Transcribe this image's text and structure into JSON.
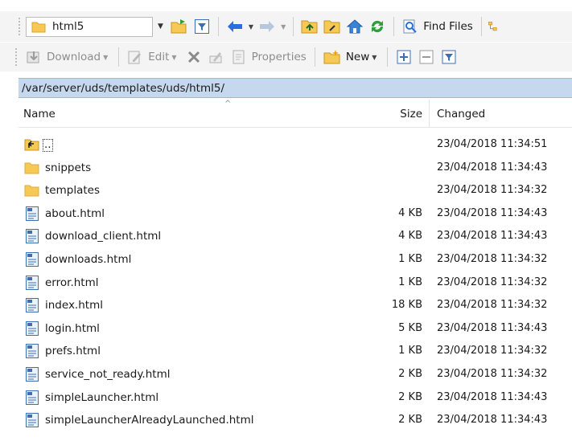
{
  "toolbar1": {
    "directory": "html5",
    "find_files": "Find Files"
  },
  "toolbar2": {
    "download": "Download",
    "edit": "Edit",
    "properties": "Properties",
    "new": "New"
  },
  "path": "/var/server/uds/templates/uds/html5/",
  "columns": {
    "name": "Name",
    "size": "Size",
    "changed": "Changed"
  },
  "rows": [
    {
      "name": "..",
      "size": "",
      "changed": "23/04/2018 11:34:51",
      "type": "parent"
    },
    {
      "name": "snippets",
      "size": "",
      "changed": "23/04/2018 11:34:43",
      "type": "folder"
    },
    {
      "name": "templates",
      "size": "",
      "changed": "23/04/2018 11:34:32",
      "type": "folder"
    },
    {
      "name": "about.html",
      "size": "4 KB",
      "changed": "23/04/2018 11:34:43",
      "type": "file"
    },
    {
      "name": "download_client.html",
      "size": "4 KB",
      "changed": "23/04/2018 11:34:43",
      "type": "file"
    },
    {
      "name": "downloads.html",
      "size": "1 KB",
      "changed": "23/04/2018 11:34:32",
      "type": "file"
    },
    {
      "name": "error.html",
      "size": "1 KB",
      "changed": "23/04/2018 11:34:32",
      "type": "file"
    },
    {
      "name": "index.html",
      "size": "18 KB",
      "changed": "23/04/2018 11:34:32",
      "type": "file"
    },
    {
      "name": "login.html",
      "size": "5 KB",
      "changed": "23/04/2018 11:34:43",
      "type": "file"
    },
    {
      "name": "prefs.html",
      "size": "1 KB",
      "changed": "23/04/2018 11:34:32",
      "type": "file"
    },
    {
      "name": "service_not_ready.html",
      "size": "2 KB",
      "changed": "23/04/2018 11:34:32",
      "type": "file"
    },
    {
      "name": "simpleLauncher.html",
      "size": "2 KB",
      "changed": "23/04/2018 11:34:43",
      "type": "file"
    },
    {
      "name": "simpleLauncherAlreadyLaunched.html",
      "size": "2 KB",
      "changed": "23/04/2018 11:34:43",
      "type": "file"
    }
  ],
  "colors": {
    "path_bar": "#c5d8ee",
    "folder": "#f6c955",
    "accent_blue": "#2a6fdb"
  }
}
